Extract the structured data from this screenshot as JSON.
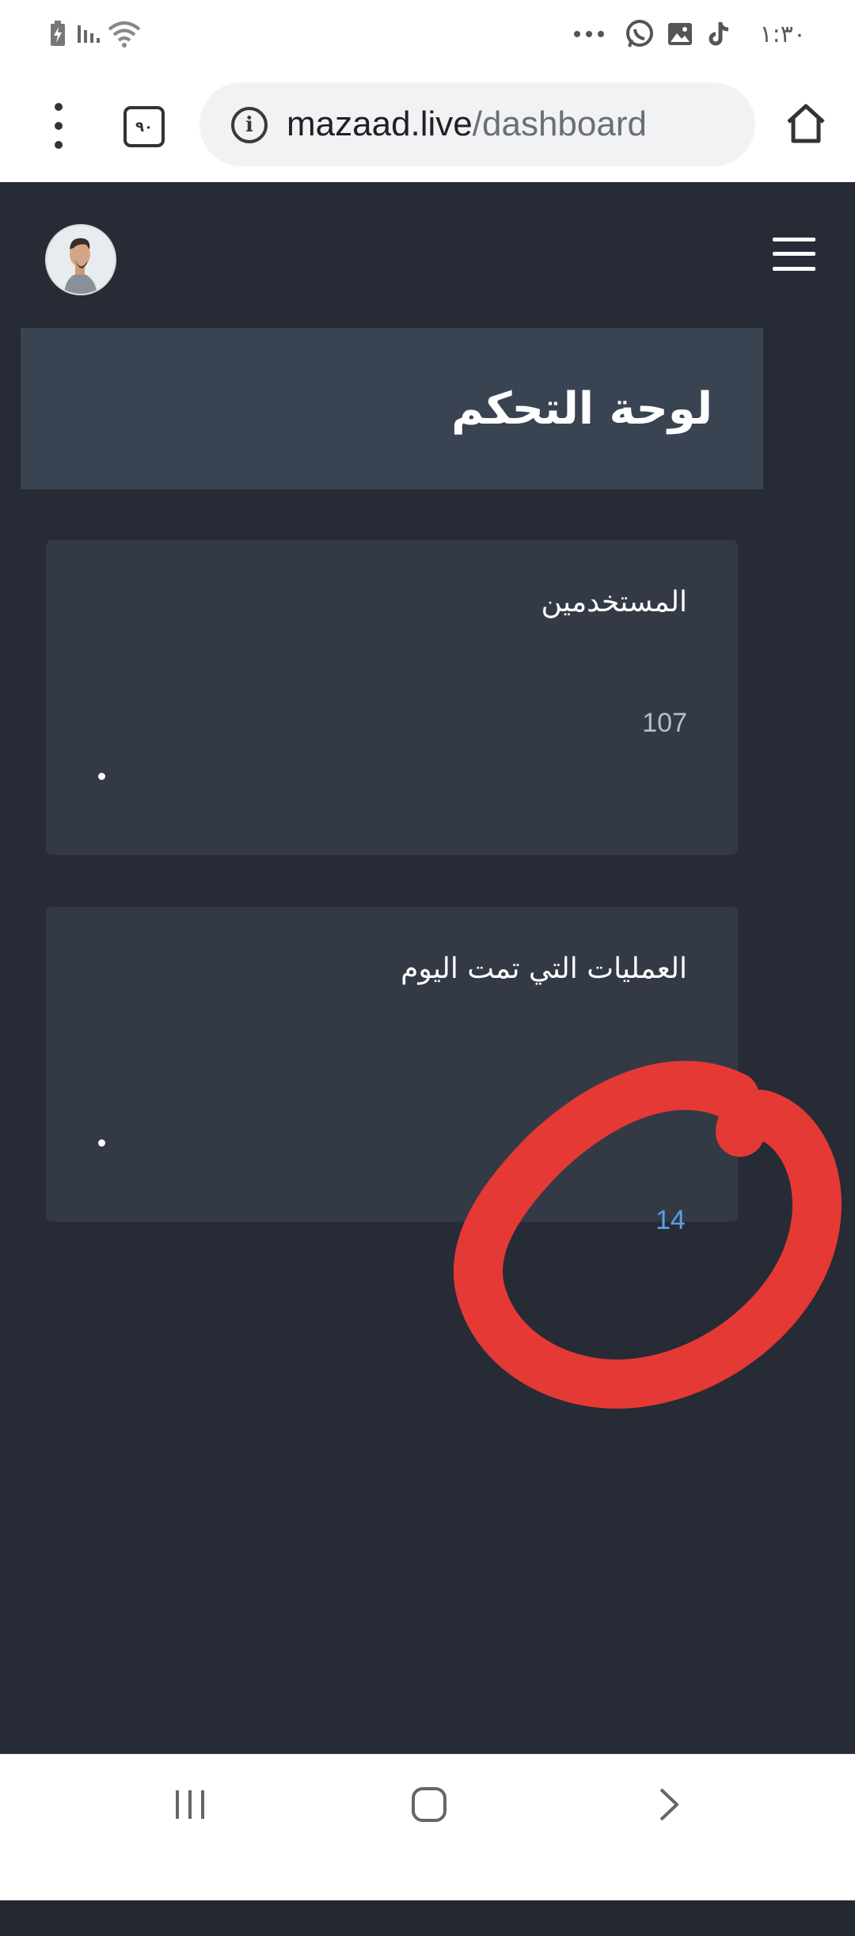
{
  "status_bar": {
    "time": "١:٣٠",
    "icons": [
      "battery-charging-icon",
      "signal-icon",
      "wifi-icon",
      "more-dots-icon",
      "whatsapp-icon",
      "gallery-icon",
      "tiktok-icon"
    ]
  },
  "browser": {
    "tab_count": "٩٠",
    "url_host": "mazaad.live",
    "url_path": "/dashboard",
    "icons": [
      "menu-kebab-icon",
      "tabs-icon",
      "info-icon",
      "home-icon"
    ]
  },
  "app": {
    "page_title": "لوحة التحكم",
    "cards": [
      {
        "title": "المستخدمين",
        "value": "107"
      },
      {
        "title": "العمليات التي تمت اليوم",
        "value": "14"
      }
    ],
    "colors": {
      "background": "#262b35",
      "header": "#394352",
      "card": "#333a46",
      "users_value": "#b8bec6",
      "operations_value": "#5aa0e6",
      "annotation": "#e53935"
    }
  },
  "nav_bar": {
    "icons": [
      "recents-icon",
      "home-nav-icon",
      "back-icon"
    ]
  }
}
